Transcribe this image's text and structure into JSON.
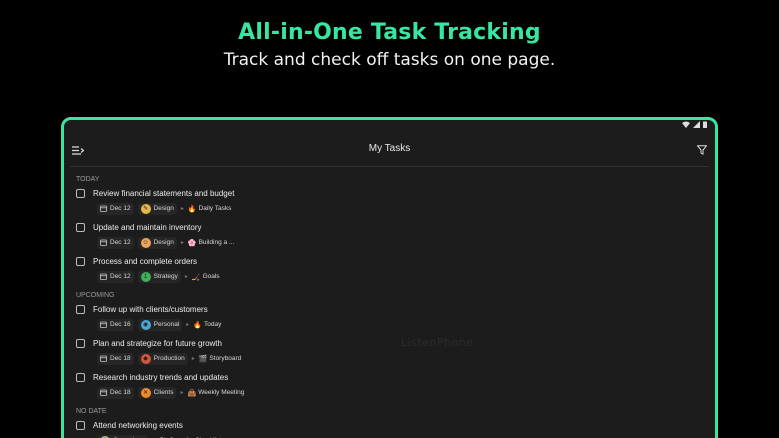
{
  "promo": {
    "headline": "All-in-One  Task Tracking",
    "subhead": "Track and check off tasks on one page."
  },
  "app": {
    "title": "My Tasks",
    "watermark": "ListenPhone"
  },
  "sections": [
    {
      "label": "TODAY",
      "tasks": [
        {
          "title": "Review financial statements and budget",
          "date": "Dec 12",
          "project": "Design",
          "project_color": "#e8b84a",
          "project_glyph": "✎",
          "list": "Daily Tasks",
          "list_icon": "🔥"
        },
        {
          "title": "Update and maintain inventory",
          "date": "Dec 12",
          "project": "Design",
          "project_color": "#f0a35a",
          "project_glyph": "☺",
          "list": "Building a ...",
          "list_icon": "🌸"
        },
        {
          "title": "Process and complete orders",
          "date": "Dec 12",
          "project": "Strategy",
          "project_color": "#3fae5a",
          "project_glyph": "1",
          "list": "Goals",
          "list_icon": "🏒"
        }
      ]
    },
    {
      "label": "UPCOMING",
      "tasks": [
        {
          "title": "Follow up with clients/customers",
          "date": "Dec 16",
          "project": "Personal",
          "project_color": "#4aa8d8",
          "project_glyph": "◉",
          "list": "Today",
          "list_icon": "🔥"
        },
        {
          "title": "Plan and strategize for future growth",
          "date": "Dec 18",
          "project": "Production",
          "project_color": "#d8543a",
          "project_glyph": "◆",
          "list": "Storyboard",
          "list_icon": "🎬"
        },
        {
          "title": "Research industry trends and updates",
          "date": "Dec 18",
          "project": "Clients",
          "project_color": "#f08a2a",
          "project_glyph": "✕",
          "list": "Weekly Meeting",
          "list_icon": "👜"
        }
      ]
    },
    {
      "label": "NO DATE",
      "tasks": [
        {
          "title": "Attend networking events",
          "date": "",
          "project": "Operations",
          "project_color": "#9ac06a",
          "project_glyph": "⚙",
          "list": "Security Checklist",
          "list_icon": "🔐"
        }
      ]
    }
  ],
  "colors": {
    "accent": "#37e6a0",
    "background": "#000000",
    "surface": "#1c1c1c"
  },
  "icons": {
    "menu": "menu-lines-icon",
    "filter": "filter-icon",
    "calendar": "calendar-icon",
    "wifi": "wifi-icon",
    "signal": "signal-icon",
    "battery": "battery-icon"
  }
}
